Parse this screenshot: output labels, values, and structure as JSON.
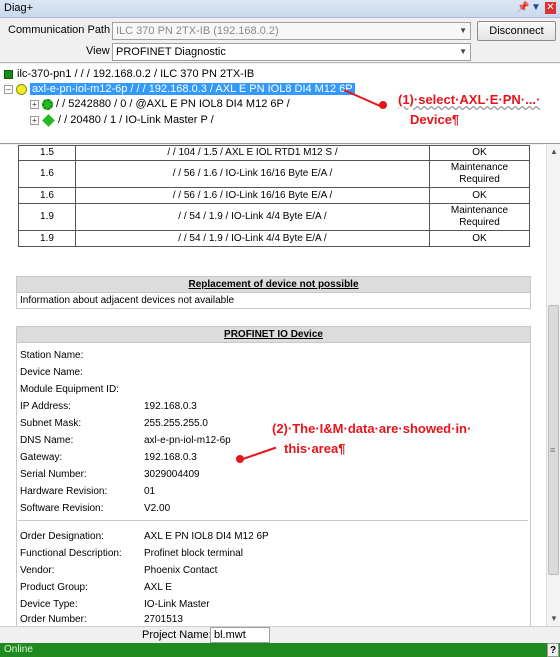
{
  "window": {
    "title": "Diag+"
  },
  "toolbar": {
    "comm_label": "Communication Path",
    "comm_value": "ILC 370 PN 2TX-IB (192.168.0.2)",
    "disconnect_label": "Disconnect",
    "view_label": "View",
    "view_value": "PROFINET Diagnostic"
  },
  "tree": {
    "root": "ilc-370-pn1 / / / 192.168.0.2 / ILC 370 PN 2TX-IB",
    "selected": "axl-e-pn-iol-m12-6p / / / 192.168.0.3 / AXL E PN IOL8 DI4 M12 6P",
    "child1": "/ / 5242880 / 0 / @AXL E PN IOL8 DI4 M12 6P /",
    "child2": "/ / 20480 / 1 / IO-Link Master P /"
  },
  "annotations": {
    "a1_line1": "(1)·select·AXL·E·PN·...·",
    "a1_line2": "Device¶",
    "a2_line1": "(2)·The·I&M·data·are·showed·in·",
    "a2_line2": "this·area¶"
  },
  "modules": [
    {
      "slot": "1.5",
      "path": "/ / 104 / 1.5 / AXL E IOL RTD1 M12 S /",
      "status": "OK"
    },
    {
      "slot": "1.6",
      "path": "/ / 56 / 1.6 / IO-Link 16/16 Byte E/A /",
      "status": "Maintenance Required"
    },
    {
      "slot": "1.6",
      "path": "/ / 56 / 1.6 / IO-Link 16/16 Byte E/A /",
      "status": "OK"
    },
    {
      "slot": "1.9",
      "path": "/ / 54 / 1.9 / IO-Link 4/4 Byte E/A /",
      "status": "Maintenance Required"
    },
    {
      "slot": "1.9",
      "path": "/ / 54 / 1.9 / IO-Link 4/4 Byte E/A /",
      "status": "OK"
    }
  ],
  "replacement": {
    "header": "Replacement of device not possible",
    "info": "Information about adjacent devices not available"
  },
  "profinet": {
    "header": "PROFINET IO Device",
    "fields": [
      {
        "label": "Station Name:",
        "value": ""
      },
      {
        "label": "Device Name:",
        "value": ""
      },
      {
        "label": "Module Equipment ID:",
        "value": ""
      },
      {
        "label": "IP Address:",
        "value": "192.168.0.3"
      },
      {
        "label": "Subnet Mask:",
        "value": "255.255.255.0"
      },
      {
        "label": "DNS Name:",
        "value": "axl-e-pn-iol-m12-6p"
      },
      {
        "label": "Gateway:",
        "value": "192.168.0.3"
      },
      {
        "label": "Serial Number:",
        "value": "3029004409"
      },
      {
        "label": "Hardware Revision:",
        "value": "01"
      },
      {
        "label": "Software Revision:",
        "value": "V2.00"
      }
    ],
    "order_fields": [
      {
        "label": "Order Designation:",
        "value": "AXL E PN IOL8 DI4 M12 6P"
      },
      {
        "label": "Functional Description:",
        "value": "Profinet block terminal"
      },
      {
        "label": "Vendor:",
        "value": "Phoenix Contact"
      },
      {
        "label": "Product Group:",
        "value": "AXL E"
      },
      {
        "label": "Device Type:",
        "value": "IO-Link Master"
      },
      {
        "label": "Order Number:",
        "value": "2701513"
      }
    ]
  },
  "project": {
    "label": "Project Name:",
    "value": "bl.mwt"
  },
  "status": {
    "text": "Online",
    "help": "?"
  },
  "colors": {
    "status_bar": "#1f8a1f",
    "annotation": "#e8141b",
    "selection": "#3399ff"
  }
}
